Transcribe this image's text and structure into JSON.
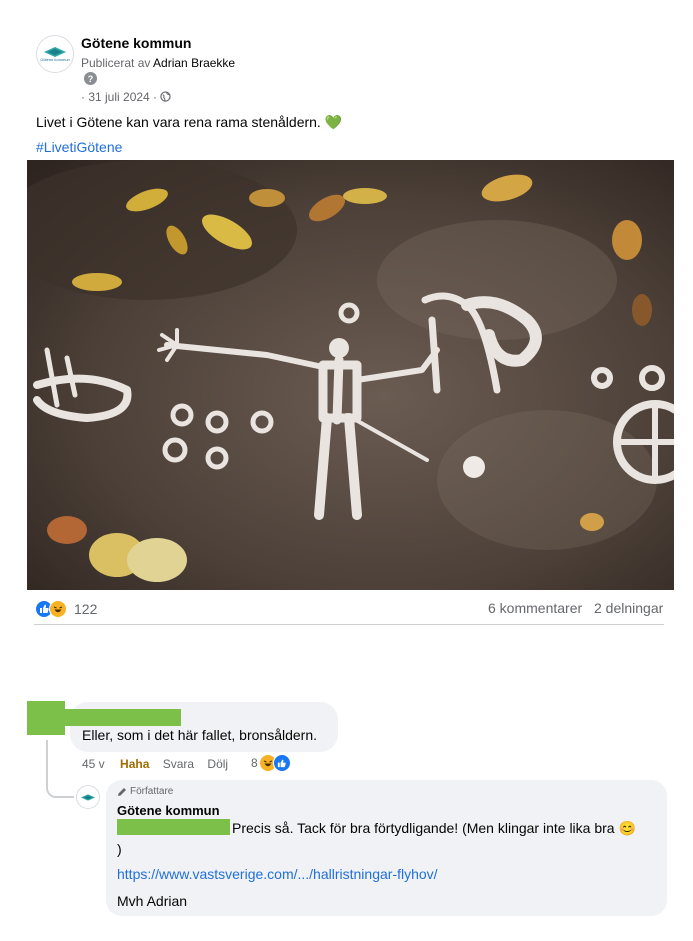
{
  "post": {
    "page_name": "Götene kommun",
    "avatar_text": "Götene kommun",
    "published_by_prefix": "Publicerat av",
    "published_by_name": "Adrian Braekke",
    "help_icon": "?",
    "date": "· 31 juli 2024 ·",
    "text": "Livet i Götene kan vara rena rama stenåldern.",
    "heart_emoji": "💚",
    "hashtag": "#LivetiGötene",
    "image_subject": "rock-carving-photo",
    "reaction_count": "122",
    "comments_count": "6 kommentarer",
    "shares_count": "2 delningar"
  },
  "comment": {
    "text": "Eller, som i det här fallet, bronsåldern.",
    "time": "45 v",
    "reaction_label": "Haha",
    "reply_label": "Svara",
    "hide_label": "Dölj",
    "reaction_count": "8"
  },
  "reply": {
    "author_badge": "Författare",
    "author_name": "Götene kommun",
    "text_line1": "Precis så. Tack för bra förtydligande! (Men klingar inte lika bra",
    "emoji": "😊",
    "text_line2": ")",
    "link": "https://www.vastsverige.com/.../hallristningar-flyhov/",
    "signature": "Mvh Adrian"
  },
  "colors": {
    "link_blue": "#216fdb",
    "redaction_green": "#7cc04a",
    "bubble_gray": "#f0f2f5",
    "like_blue": "#1877f2",
    "haha_yellow": "#f7b125",
    "heart_green": "#45bd62"
  }
}
